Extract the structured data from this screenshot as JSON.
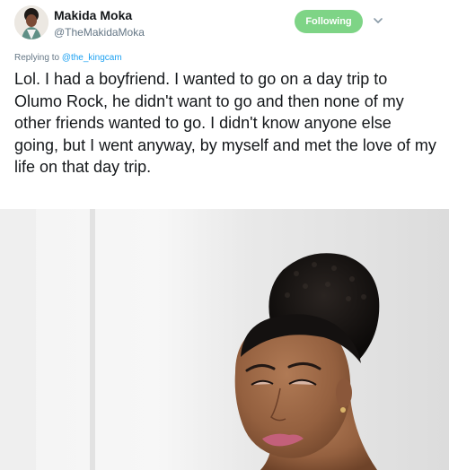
{
  "tweet": {
    "author": {
      "display_name": "Makida Moka",
      "handle": "@TheMakidaMoka"
    },
    "follow_button_label": "Following",
    "reply": {
      "prefix": "Replying to",
      "mention": "@the_kingcam"
    },
    "text": "Lol. I had a boyfriend. I wanted to go on a day trip to Olumo Rock, he didn't want to go and then none of my other friends wanted to go. I didn't know anyone else going, but I went anyway, by myself and met the love of my life on that day trip."
  },
  "icons": {
    "avatar": "profile-photo",
    "caret": "chevron-down-icon"
  },
  "colors": {
    "follow_button": "#7ed486",
    "mention": "#1da1f2",
    "secondary_text": "#657786",
    "primary_text": "#14171a"
  }
}
